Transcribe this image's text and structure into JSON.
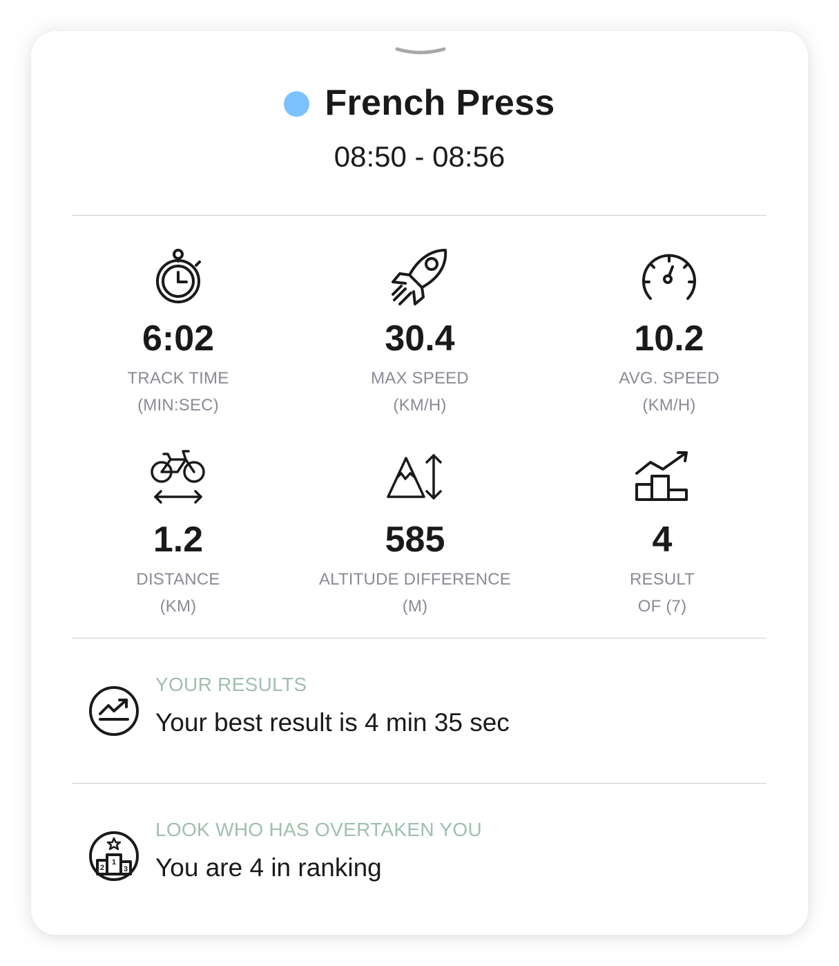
{
  "session": {
    "title": "French Press",
    "time_range": "08:50 - 08:56",
    "dot_color": "#7cc2ff"
  },
  "stats": {
    "track_time": {
      "value": "6:02",
      "label": "TRACK TIME",
      "unit": "(MIN:SEC)",
      "icon": "stopwatch-icon"
    },
    "max_speed": {
      "value": "30.4",
      "label": "MAX SPEED",
      "unit": "(KM/H)",
      "icon": "rocket-icon"
    },
    "avg_speed": {
      "value": "10.2",
      "label": "AVG. SPEED",
      "unit": "(KM/H)",
      "icon": "speedometer-icon"
    },
    "distance": {
      "value": "1.2",
      "label": "DISTANCE",
      "unit": "(KM)",
      "icon": "bike-distance-icon"
    },
    "altitude": {
      "value": "585",
      "label": "ALTITUDE DIFFERENCE",
      "unit": "(M)",
      "icon": "mountain-altitude-icon"
    },
    "result": {
      "value": "4",
      "label": "RESULT",
      "unit": "OF (7)",
      "icon": "podium-trend-icon"
    }
  },
  "your_results": {
    "heading": "YOUR RESULTS",
    "text": "Your best result is 4 min 35 sec",
    "icon": "trend-circle-icon"
  },
  "overtaken": {
    "heading": "LOOK WHO HAS OVERTAKEN YOU",
    "text": "You are 4 in ranking",
    "icon": "podium-circle-icon"
  },
  "colors": {
    "accent_heading": "#9fbfae",
    "label_gray": "#8a8a96",
    "text_dark": "#1a1a1a"
  }
}
